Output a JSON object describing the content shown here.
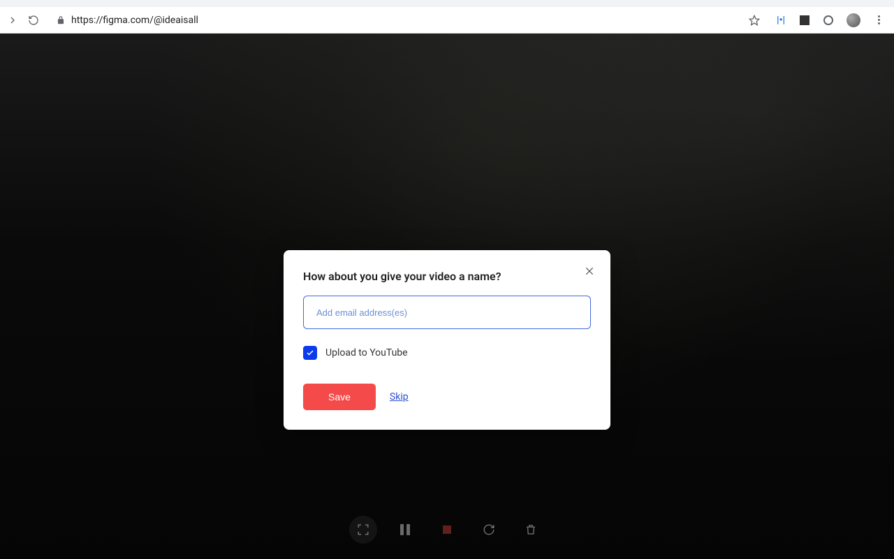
{
  "browser": {
    "url": "https://figma.com/@ideaisall"
  },
  "modal": {
    "title": "How about you give your video a name?",
    "input_placeholder": "Add email address(es)",
    "input_value": "",
    "checkbox_label": "Upload to YouTube",
    "checkbox_checked": true,
    "save_label": "Save",
    "skip_label": "Skip"
  },
  "colors": {
    "primary_button": "#f44a4a",
    "link": "#2a4cd4",
    "checkbox": "#0b3bec",
    "input_border": "#4169e1"
  }
}
